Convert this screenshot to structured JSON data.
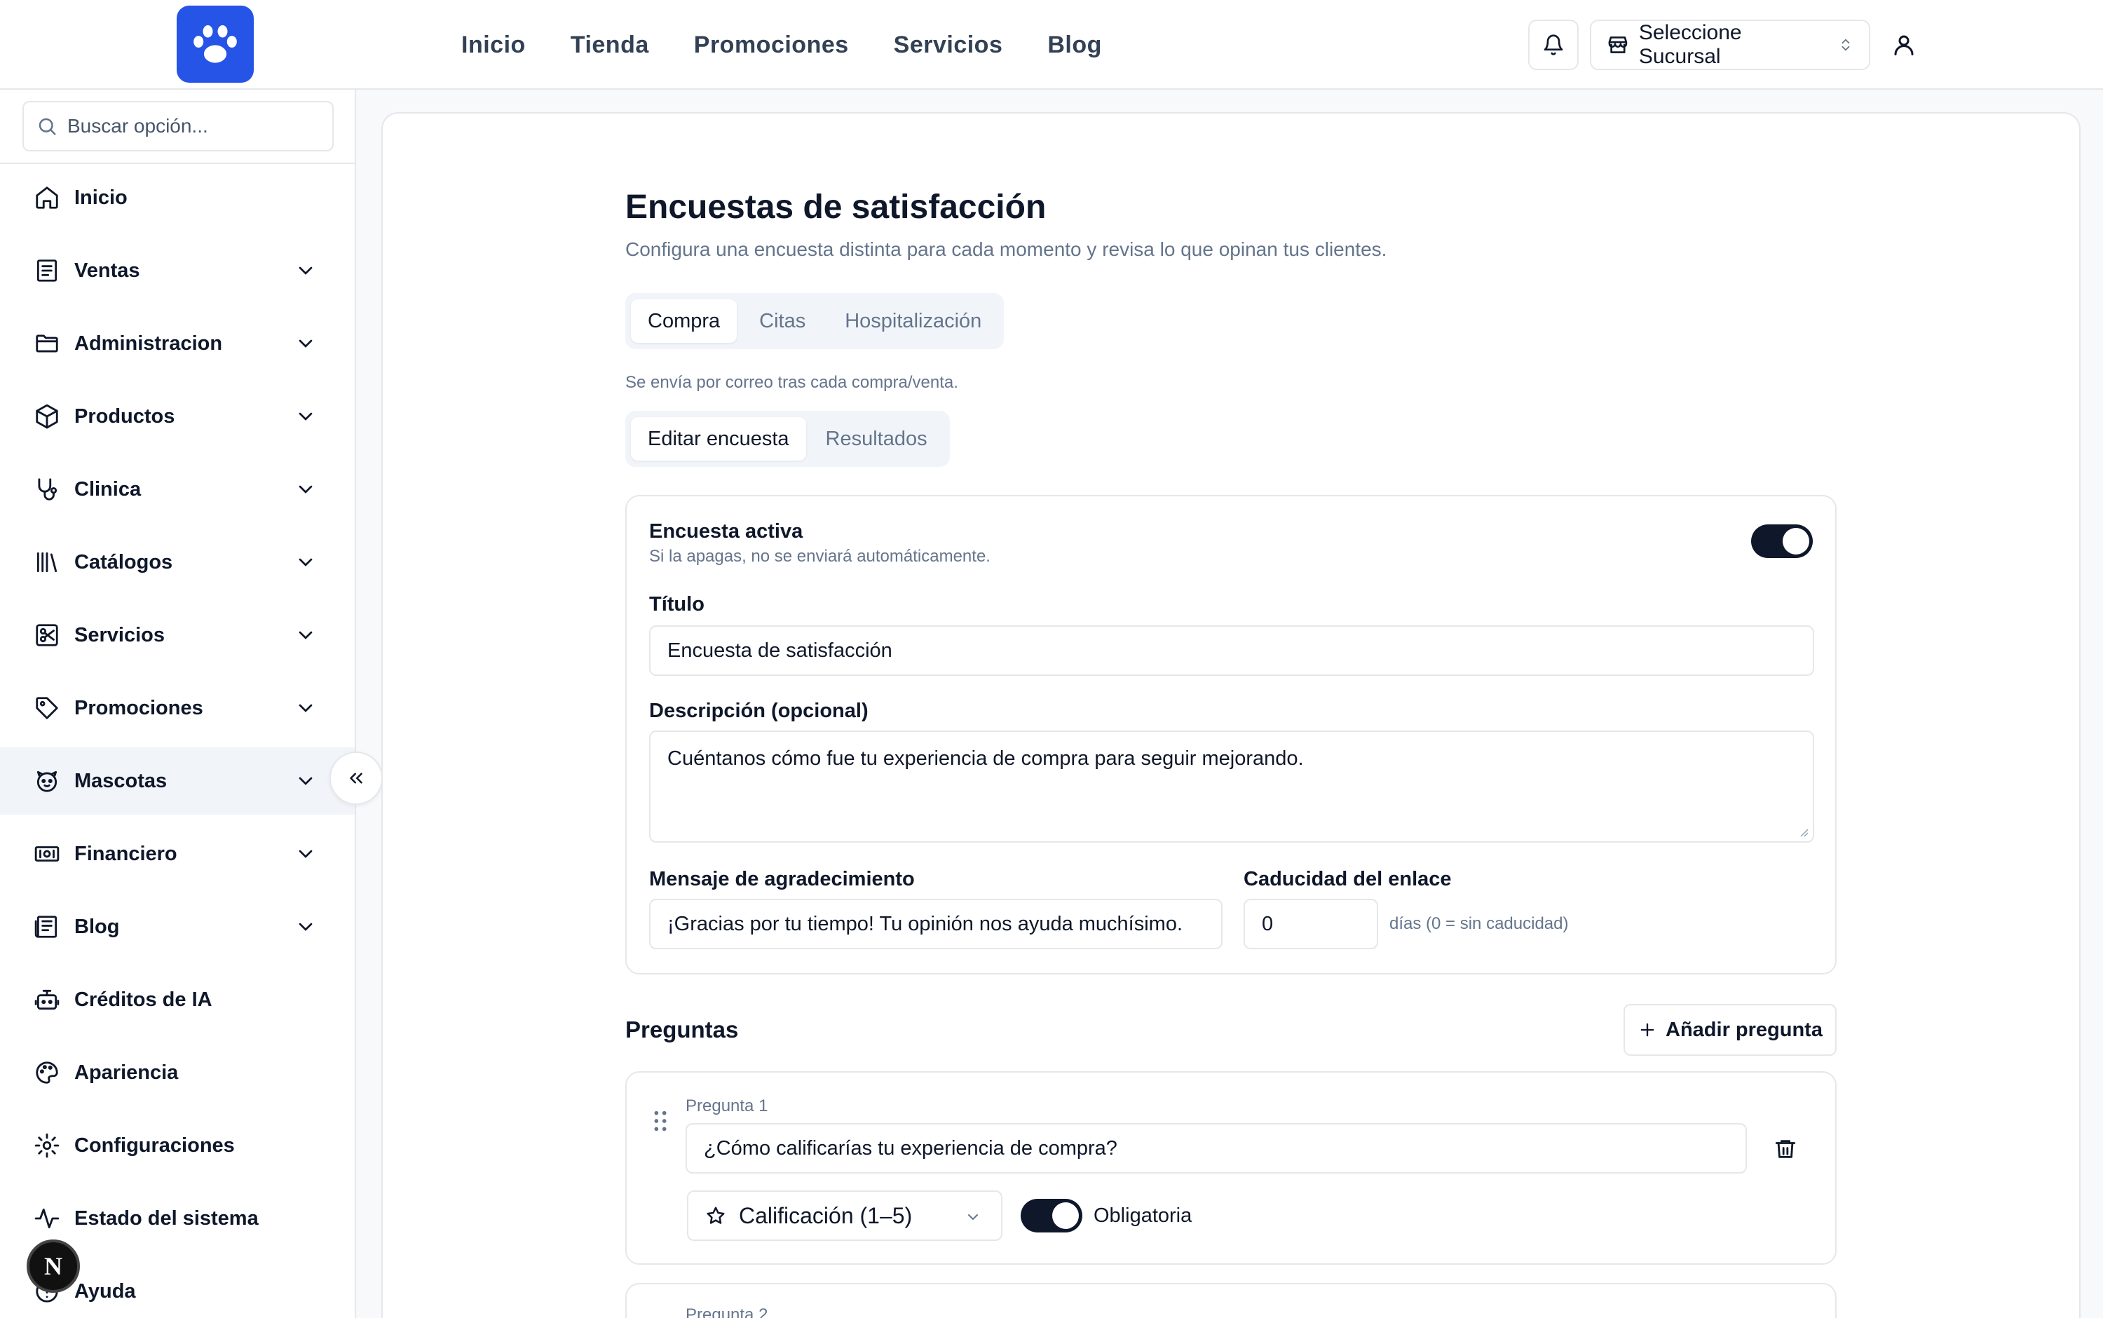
{
  "nav": {
    "links": [
      "Inicio",
      "Tienda",
      "Promociones",
      "Servicios",
      "Blog"
    ],
    "branch_label": "Seleccione Sucursal"
  },
  "sidebar": {
    "search_placeholder": "Buscar opción...",
    "items": [
      {
        "label": "Inicio",
        "icon": "home-icon",
        "expandable": false
      },
      {
        "label": "Ventas",
        "icon": "receipt-icon",
        "expandable": true
      },
      {
        "label": "Administracion",
        "icon": "folder-icon",
        "expandable": true
      },
      {
        "label": "Productos",
        "icon": "package-icon",
        "expandable": true
      },
      {
        "label": "Clinica",
        "icon": "stethoscope-icon",
        "expandable": true
      },
      {
        "label": "Catálogos",
        "icon": "library-icon",
        "expandable": true
      },
      {
        "label": "Servicios",
        "icon": "scissors-icon",
        "expandable": true
      },
      {
        "label": "Promociones",
        "icon": "tag-icon",
        "expandable": true
      },
      {
        "label": "Mascotas",
        "icon": "pet-icon",
        "expandable": true,
        "active": true
      },
      {
        "label": "Financiero",
        "icon": "banknote-icon",
        "expandable": true
      },
      {
        "label": "Blog",
        "icon": "newspaper-icon",
        "expandable": true
      },
      {
        "label": "Créditos de IA",
        "icon": "bot-icon",
        "expandable": false
      },
      {
        "label": "Apariencia",
        "icon": "palette-icon",
        "expandable": false
      },
      {
        "label": "Configuraciones",
        "icon": "gear-icon",
        "expandable": false
      },
      {
        "label": "Estado del sistema",
        "icon": "activity-icon",
        "expandable": false
      },
      {
        "label": "Ayuda",
        "icon": "help-icon",
        "expandable": false
      }
    ]
  },
  "page": {
    "title": "Encuestas de satisfacción",
    "subtitle": "Configura una encuesta distinta para cada momento y revisa lo que opinan tus clientes.",
    "tabs": [
      "Compra",
      "Citas",
      "Hospitalización"
    ],
    "hint": "Se envía por correo tras cada compra/venta.",
    "subtabs": [
      "Editar encuesta",
      "Resultados"
    ]
  },
  "settings": {
    "active_label": "Encuesta activa",
    "active_hint": "Si la apagas, no se enviará automáticamente.",
    "active_on": true,
    "title_label": "Título",
    "title_value": "Encuesta de satisfacción",
    "description_label": "Descripción (opcional)",
    "description_value": "Cuéntanos cómo fue tu experiencia de compra para seguir mejorando.",
    "thanks_label": "Mensaje de agradecimiento",
    "thanks_value": "¡Gracias por tu tiempo! Tu opinión nos ayuda muchísimo.",
    "expiry_label": "Caducidad del enlace",
    "expiry_value": "0",
    "expiry_hint": "días (0 = sin caducidad)"
  },
  "questions": {
    "title": "Preguntas",
    "add_label": "Añadir pregunta",
    "items": [
      {
        "label": "Pregunta 1",
        "text": "¿Cómo calificarías tu experiencia de compra?",
        "type": "Calificación (1–5)",
        "required_label": "Obligatoria",
        "required": true
      },
      {
        "label": "Pregunta 2"
      }
    ]
  },
  "colors": {
    "brand": "#2554e6",
    "toggle": "#0f172a",
    "muted": "#64748b"
  }
}
